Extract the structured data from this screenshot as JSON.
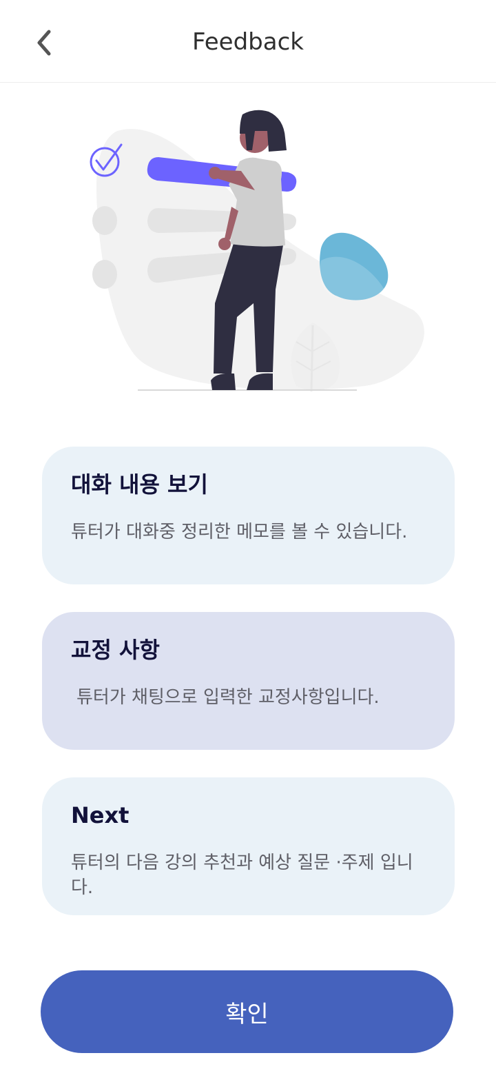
{
  "header": {
    "title": "Feedback",
    "back_icon": "chevron-left-icon"
  },
  "illustration": {
    "name": "woman-with-checklist-illustration",
    "accent_color": "#6c63ff",
    "blob_color": "#6bb7d8"
  },
  "cards": [
    {
      "title": "대화 내용 보기",
      "description": "튜터가 대화중 정리한 메모를 볼 수 있습니다.",
      "background": "#eaf2f8"
    },
    {
      "title": "교정 사항",
      "description": "튜터가 채팅으로 입력한 교정사항입니다.",
      "background": "#dde1f1"
    },
    {
      "title": "Next",
      "description": "튜터의 다음 강의 추천과 예상 질문 ·주제 입니다.",
      "background": "#eaf2f8"
    }
  ],
  "confirm": {
    "label": "확인",
    "color": "#4562bd"
  }
}
